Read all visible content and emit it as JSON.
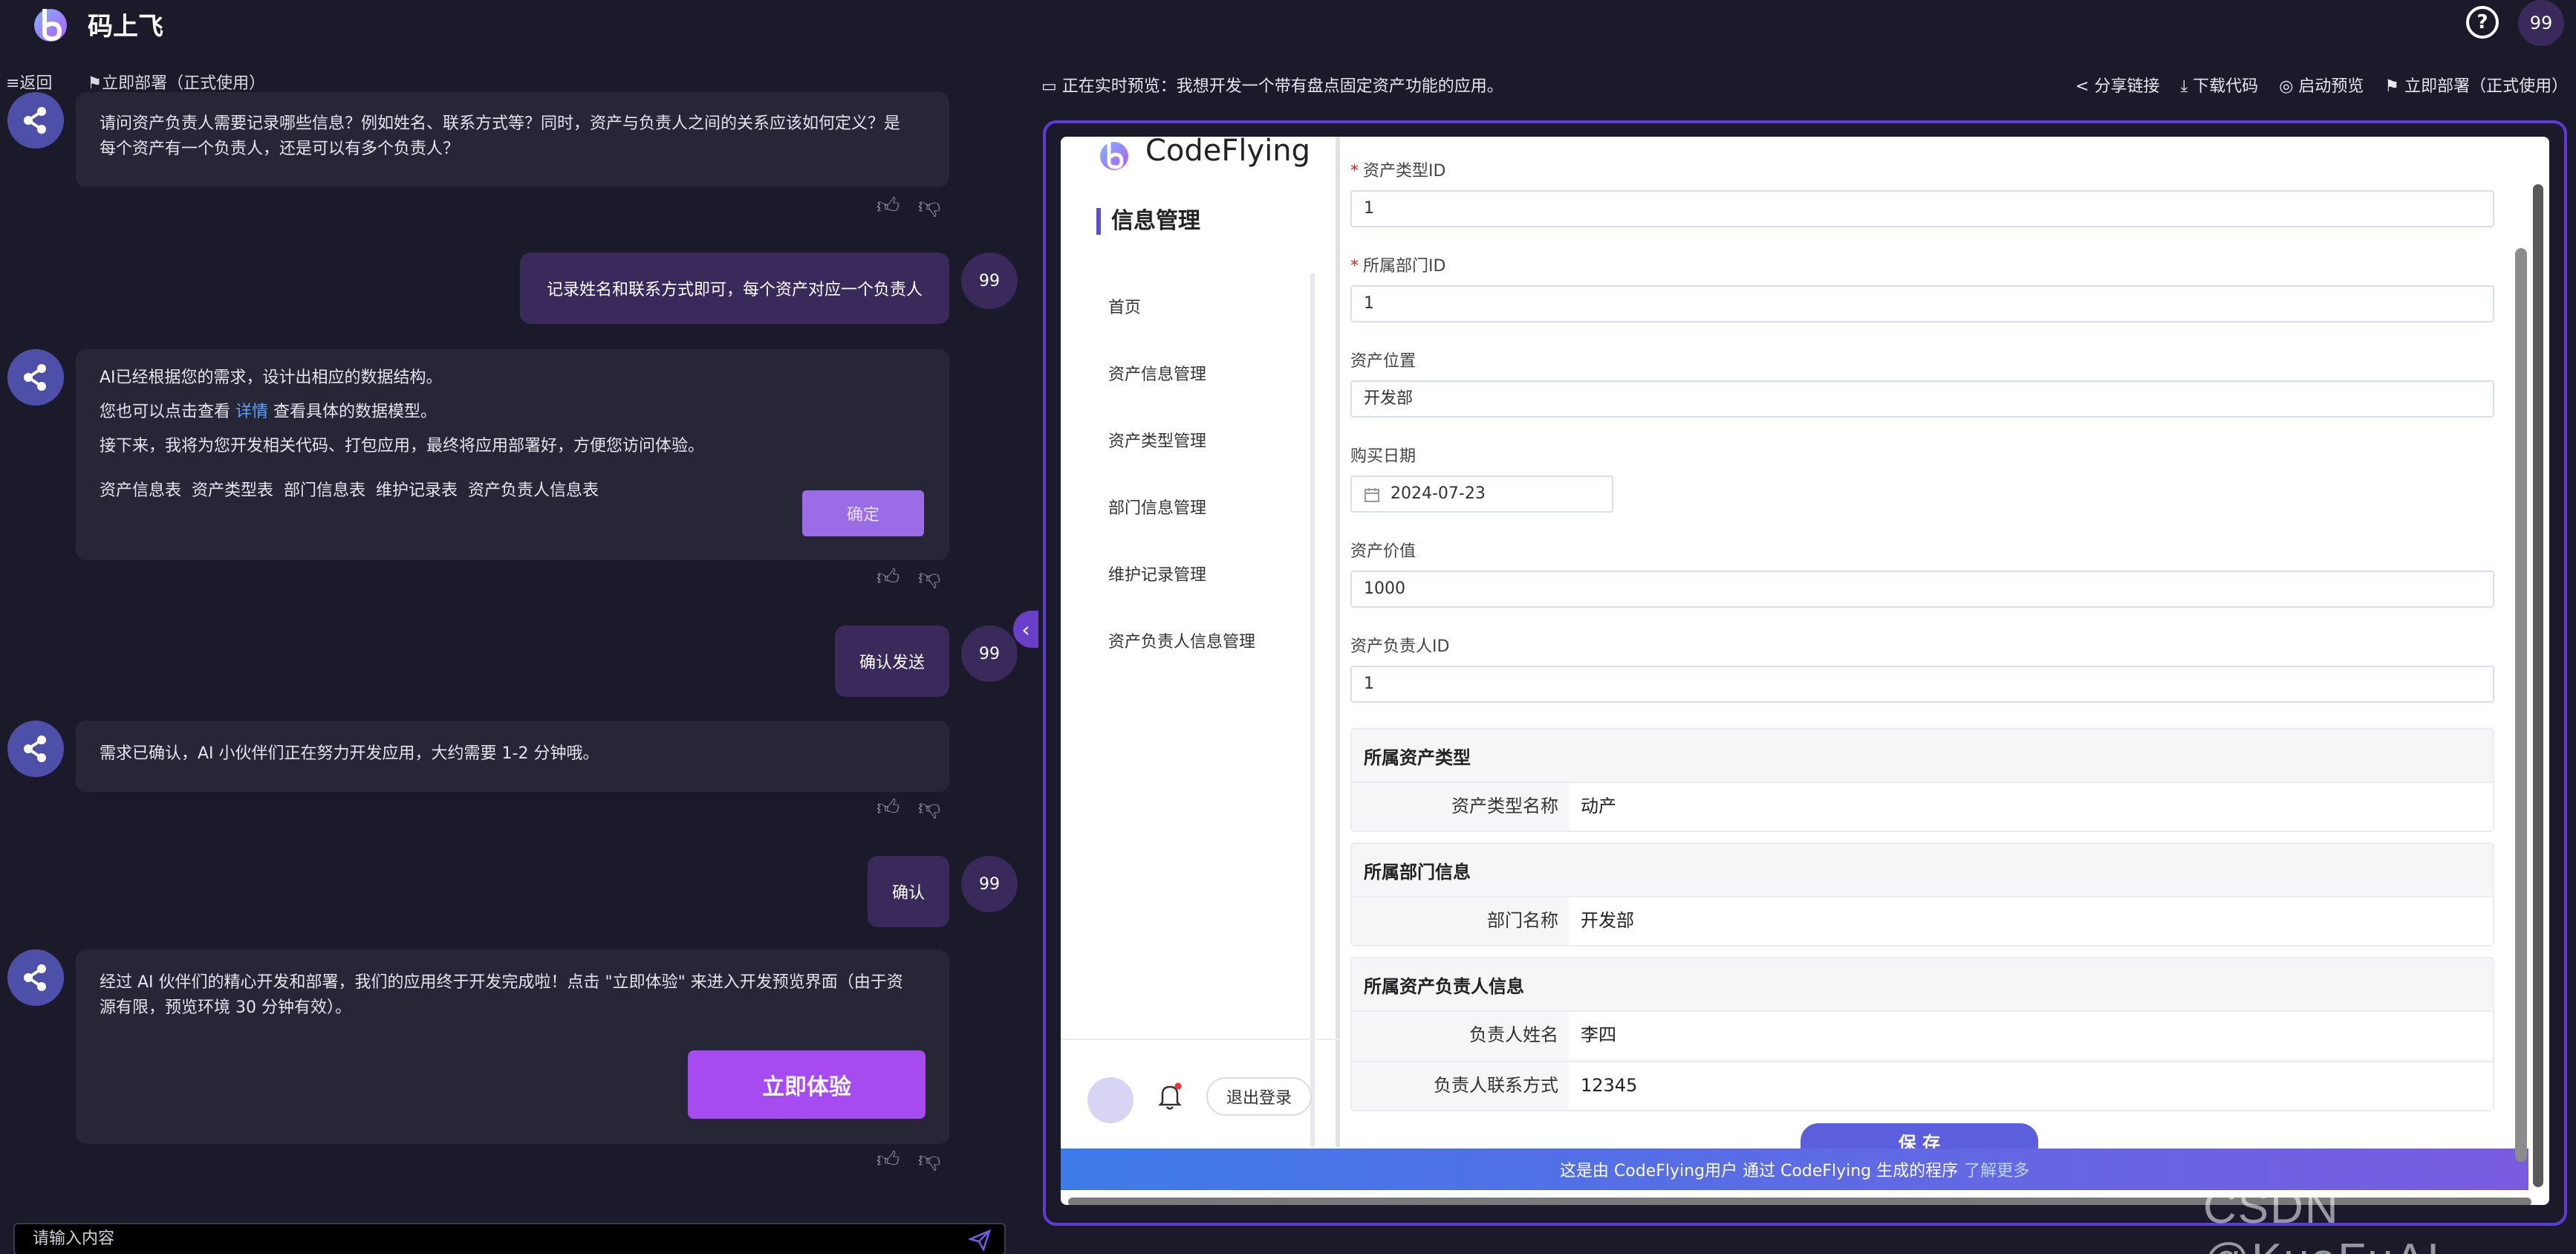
{
  "app": {
    "title": "码上飞",
    "avatar": "99"
  },
  "subbar": {
    "back": "≡返回",
    "deploy": "⚑立即部署（正式使用）",
    "preview_status": "正在实时预览：我想开发一个带有盘点固定资产功能的应用。",
    "actions": [
      "分享链接",
      "下载代码",
      "启动预览",
      "立即部署（正式使用）"
    ]
  },
  "chat": {
    "messages": [
      {
        "role": "ai",
        "lines": [
          "请问资产负责人需要记录哪些信息？例如姓名、联系方式等？同时，资产与负责人之间的关系应该如何定义？是",
          "每个资产有一个负责人，还是可以有多个负责人？"
        ]
      },
      {
        "role": "user",
        "text": "记录姓名和联系方式即可，每个资产对应一个负责人",
        "avatar": "99"
      },
      {
        "role": "ai",
        "line1": "AI已经根据您的需求，设计出相应的数据结构。",
        "line2_pre": "您也可以点击查看",
        "line2_link": "详情",
        "line2_post": "查看具体的数据模型。",
        "line3": "接下来，我将为您开发相关代码、打包应用，最终将应用部署好，方便您访问体验。",
        "tables": "资产信息表  资产类型表  部门信息表  维护记录表  资产负责人信息表",
        "button": "确定"
      },
      {
        "role": "user",
        "text": "确认发送",
        "avatar": "99"
      },
      {
        "role": "ai",
        "text": "需求已确认，AI 小伙伴们正在努力开发应用，大约需要 1-2 分钟哦。"
      },
      {
        "role": "user",
        "text": "确认",
        "avatar": "99"
      },
      {
        "role": "ai",
        "lines": [
          "经过 AI 伙伴们的精心开发和部署，我们的应用终于开发完成啦！点击 \"立即体验\" 来进入开发预览界面（由于资",
          "源有限，预览环境 30 分钟有效）。"
        ],
        "button": "立即体验"
      }
    ],
    "input_placeholder": "请输入内容"
  },
  "preview": {
    "brand": "CodeFlying",
    "section": "信息管理",
    "menu": [
      "首页",
      "资产信息管理",
      "资产类型管理",
      "部门信息管理",
      "维护记录管理",
      "资产负责人信息管理"
    ],
    "logout": "退出登录",
    "form": {
      "fields": [
        {
          "label": "资产类型ID",
          "required": true,
          "value": "1"
        },
        {
          "label": "所属部门ID",
          "required": true,
          "value": "1"
        },
        {
          "label": "资产位置",
          "required": false,
          "value": "开发部"
        },
        {
          "label": "购买日期",
          "required": false,
          "value": "2024-07-23"
        },
        {
          "label": "资产价值",
          "required": false,
          "value": "1000"
        },
        {
          "label": "资产负责人ID",
          "required": false,
          "value": "1"
        }
      ],
      "cards": [
        {
          "title": "所属资产类型",
          "rows": [
            {
              "k": "资产类型名称",
              "v": "动产"
            }
          ]
        },
        {
          "title": "所属部门信息",
          "rows": [
            {
              "k": "部门名称",
              "v": "开发部"
            }
          ]
        },
        {
          "title": "所属资产负责人信息",
          "rows": [
            {
              "k": "负责人姓名",
              "v": "李四"
            },
            {
              "k": "负责人联系方式",
              "v": "12345"
            }
          ]
        }
      ],
      "save": "保 存"
    },
    "banner": {
      "text": "这是由 CodeFlying用户 通过 CodeFlying 生成的程序",
      "more": "了解更多"
    }
  },
  "watermark": "CSDN @KuaFuAI",
  "colors": {
    "bg": "#1b1a2a",
    "accent": "#5f3ad6",
    "user_bubble": "#3a2a5c",
    "ai_bubble": "#262637",
    "try_button": "#a64bf0"
  }
}
